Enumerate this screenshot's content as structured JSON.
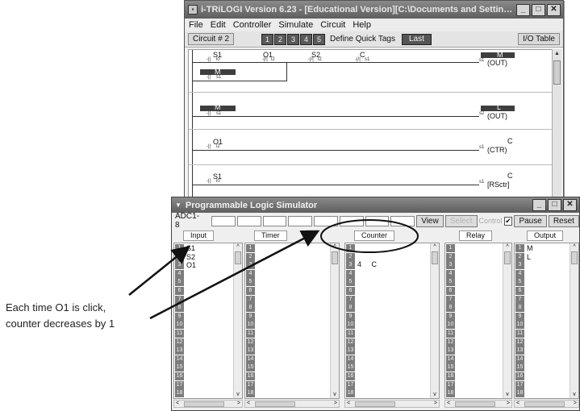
{
  "main_window": {
    "title": "i-TRiLOGI Version 6.23 - [Educational Version][C:\\Documents and Settings\\All Users\\D...",
    "menu": [
      "File",
      "Edit",
      "Controller",
      "Simulate",
      "Circuit",
      "Help"
    ],
    "toolbar": {
      "circuit_label": "Circuit # 2",
      "quick_tags": [
        "1",
        "2",
        "3",
        "4",
        "5"
      ],
      "define_quick_tags": "Define Quick Tags",
      "last": "Last",
      "io_table": "I/O Table"
    },
    "rungs": [
      {
        "contacts": [
          {
            "name": "S1",
            "tag": "i0"
          },
          {
            "name": "O1",
            "tag": "i2"
          },
          {
            "name": "S2",
            "tag": "i2"
          },
          {
            "name": "C",
            "tag": "s1"
          }
        ],
        "branch": {
          "name": "M",
          "tag": "s1"
        },
        "output": {
          "name": "M",
          "type": "(OUT)",
          "tag": "s1"
        }
      },
      {
        "contacts": [
          {
            "name": "M",
            "tag": "s1"
          }
        ],
        "output": {
          "name": "L",
          "type": "(OUT)",
          "tag": "s2"
        }
      },
      {
        "contacts": [
          {
            "name": "O1",
            "tag": "i2"
          }
        ],
        "output": {
          "name": "C",
          "type": "(CTR)",
          "tag": "s1"
        }
      },
      {
        "contacts": [
          {
            "name": "S1",
            "tag": "i0"
          }
        ],
        "output": {
          "name": "C",
          "type": "[RSctr]",
          "tag": "s1"
        }
      }
    ]
  },
  "simulator_window": {
    "title": "Programmable Logic Simulator",
    "adc_label": "ADC1-8",
    "buttons": {
      "view": "View",
      "select": "Select",
      "control": "Control",
      "pause": "Pause",
      "reset": "Reset"
    },
    "control_checked": "✔",
    "panels": [
      {
        "header": "Input",
        "entries": [
          "S1",
          "S2",
          "O1"
        ]
      },
      {
        "header": "Timer",
        "entries": []
      },
      {
        "header": "Counter",
        "entries": [
          "4     C"
        ]
      },
      {
        "header": "Relay",
        "entries": []
      },
      {
        "header": "Output",
        "entries": [
          "M",
          "L"
        ]
      }
    ],
    "row_numbers": [
      "1",
      "2",
      "3",
      "4",
      "5",
      "6",
      "7",
      "8",
      "9",
      "10",
      "11",
      "12",
      "13",
      "14",
      "15",
      "16",
      "17",
      "18"
    ]
  },
  "annotation": {
    "line1": "Each time O1 is click,",
    "line2": "counter decreases by 1"
  },
  "colors": {
    "title_bar": "#6f6f6f",
    "number_cell": "#7c7c7c",
    "dark_block": "#3e3e3e"
  }
}
